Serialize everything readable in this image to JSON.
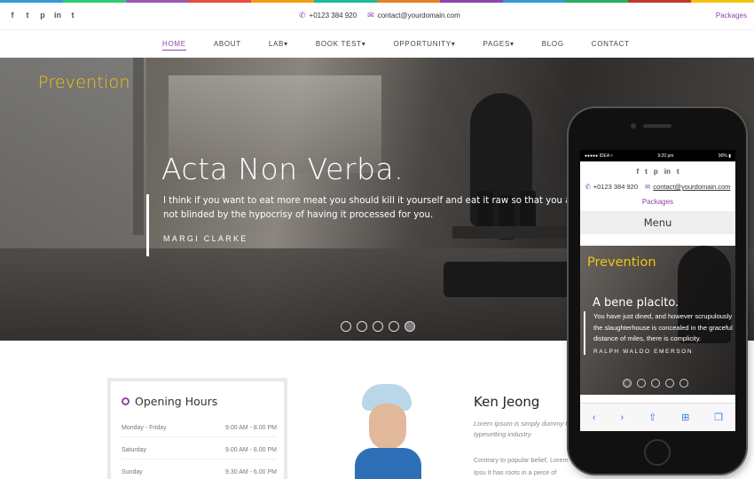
{
  "colors": {
    "accent": "#8e44ad",
    "hero_tag": "#f1c40f",
    "strip": [
      "#3498db",
      "#2ecc71",
      "#9b59b6",
      "#e74c3c",
      "#f39c12",
      "#1abc9c",
      "#e67e22",
      "#8e44ad",
      "#3498db",
      "#27ae60",
      "#c0392b",
      "#f1c40f"
    ]
  },
  "topbar": {
    "socials": [
      {
        "icon": "facebook-icon",
        "glyph": "f"
      },
      {
        "icon": "twitter-icon",
        "glyph": "t"
      },
      {
        "icon": "pinterest-icon",
        "glyph": "p"
      },
      {
        "icon": "linkedin-icon",
        "glyph": "in"
      },
      {
        "icon": "tumblr-icon",
        "glyph": "t"
      }
    ],
    "phone": "+0123 384 920",
    "email": "contact@yourdomain.com",
    "packages": "Packages"
  },
  "nav": {
    "items": [
      {
        "label": "HOME",
        "active": true
      },
      {
        "label": "ABOUT"
      },
      {
        "label": "LAB▾"
      },
      {
        "label": "BOOK TEST▾"
      },
      {
        "label": "OPPORTUNITY▾"
      },
      {
        "label": "PAGES▾"
      },
      {
        "label": "BLOG"
      },
      {
        "label": "CONTACT"
      }
    ]
  },
  "hero": {
    "tag": "Prevention",
    "title": "Acta Non Verba.",
    "quote_line1": "I think if you want to eat more meat you should kill it yourself and eat it raw so that you ar",
    "quote_line2": "not blinded by the hypocrisy of having it processed for you.",
    "author": "MARGI CLARKE",
    "slides": 5,
    "active_slide": 5
  },
  "hours": {
    "title": "Opening Hours",
    "rows": [
      {
        "day": "Monday - Friday",
        "time": "9.00 AM - 8.00 PM"
      },
      {
        "day": "Saturday",
        "time": "9.00 AM - 8.00 PM"
      },
      {
        "day": "Sunday",
        "time": "9.30 AM - 6.00 PM"
      }
    ]
  },
  "doctor": {
    "name": "Ken Jeong",
    "desc": "Lorem Ipsum is simply dummy te typesetting industry",
    "body": "Contrary to popular belief, Lorem Ipsu It has roots in a piece of classical Lat"
  },
  "phone": {
    "status_left": "●●●●● IDEA ≈",
    "status_time": "9:20 pm",
    "status_right": "90% ▮",
    "phone_number": "+0123 384 920",
    "email": "contact@yourdomain.com",
    "packages": "Packages",
    "menu": "Menu",
    "tag": "Prevention",
    "title": "A bene placito.",
    "quote": "You have just dined, and however scrupulously the slaughterhouse is concealed in the graceful distance of miles, there is complicity.",
    "author": "RALPH WALDO EMERSON",
    "slides": 5,
    "active_slide": 1,
    "toolbar": [
      {
        "icon": "back-icon",
        "glyph": "‹"
      },
      {
        "icon": "forward-icon",
        "glyph": "›"
      },
      {
        "icon": "share-icon",
        "glyph": "⇧"
      },
      {
        "icon": "bookmarks-icon",
        "glyph": "⊞"
      },
      {
        "icon": "tabs-icon",
        "glyph": "❐"
      }
    ]
  }
}
